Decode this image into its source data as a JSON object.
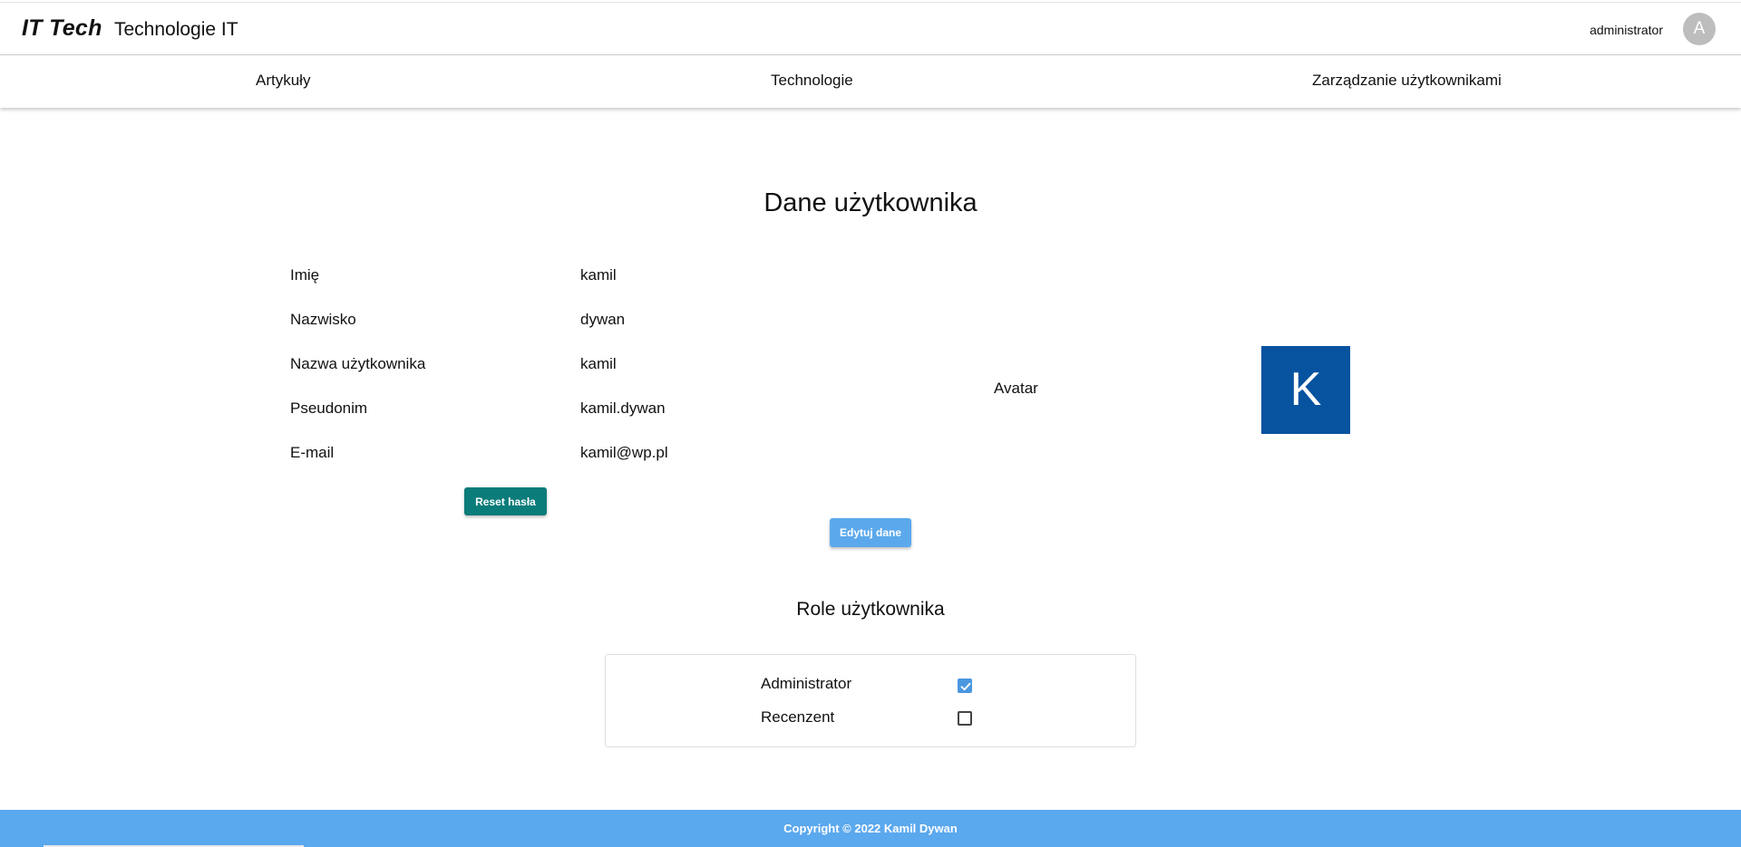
{
  "header": {
    "logo": "IT Tech",
    "title": "Technologie IT",
    "user_name": "administrator",
    "avatar_letter": "A"
  },
  "nav": {
    "items": [
      {
        "label": "Artykuły"
      },
      {
        "label": "Technologie"
      },
      {
        "label": "Zarządzanie użytkownikami"
      }
    ]
  },
  "main": {
    "title": "Dane użytkownika",
    "fields": [
      {
        "label": "Imię",
        "value": "kamil"
      },
      {
        "label": "Nazwisko",
        "value": "dywan"
      },
      {
        "label": "Nazwa użytkownika",
        "value": "kamil"
      },
      {
        "label": "Pseudonim",
        "value": "kamil.dywan"
      },
      {
        "label": "E-mail",
        "value": "kamil@wp.pl"
      }
    ],
    "avatar_label": "Avatar",
    "avatar_letter": "K",
    "reset_button": "Reset hasła",
    "edit_button": "Edytuj dane"
  },
  "roles": {
    "title": "Role użytkownika",
    "items": [
      {
        "label": "Administrator",
        "checked": true
      },
      {
        "label": "Recenzent",
        "checked": false
      }
    ]
  },
  "footer": {
    "text": "Copyright © 2022 Kamil Dywan"
  },
  "colors": {
    "avatar_bg": "#07539f",
    "reset_button": "#0a7c7a",
    "edit_button": "#5ba9ec",
    "footer": "#5aa8ee",
    "checkbox_checked": "#4a97e0"
  }
}
